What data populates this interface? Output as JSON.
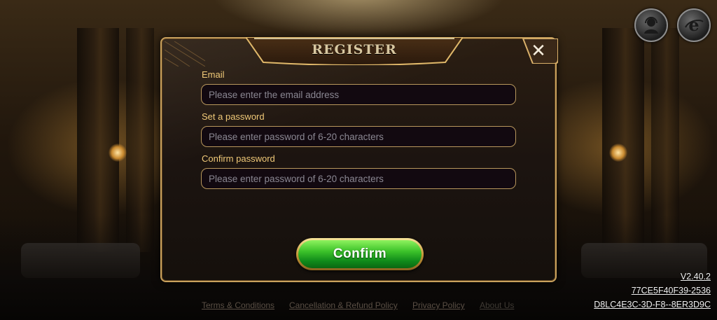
{
  "dialog": {
    "title": "REGISTER",
    "close_label": "✕",
    "fields": [
      {
        "label": "Email",
        "placeholder": "Please enter the email address",
        "value": ""
      },
      {
        "label": "Set a password",
        "placeholder": "Please enter password of 6-20 characters",
        "value": ""
      },
      {
        "label": "Confirm password",
        "placeholder": "Please enter password of 6-20 characters",
        "value": ""
      }
    ],
    "confirm_label": "Confirm"
  },
  "top_icons": [
    "customer-service-icon",
    "browser-e-icon"
  ],
  "footer": {
    "links": [
      "Terms & Conditions",
      "Cancellation & Refund Policy",
      "Privacy Policy",
      "About Us"
    ]
  },
  "build_info": {
    "version": "V2.40.2",
    "code1": "77CE5F40F39-2536",
    "code2": "D8LC4E3C-3D-F8--8ER3D9C"
  },
  "colors": {
    "dialog_border": "#c9a15d",
    "label_gold": "#f0c978",
    "confirm_green": "#3cc22a"
  }
}
